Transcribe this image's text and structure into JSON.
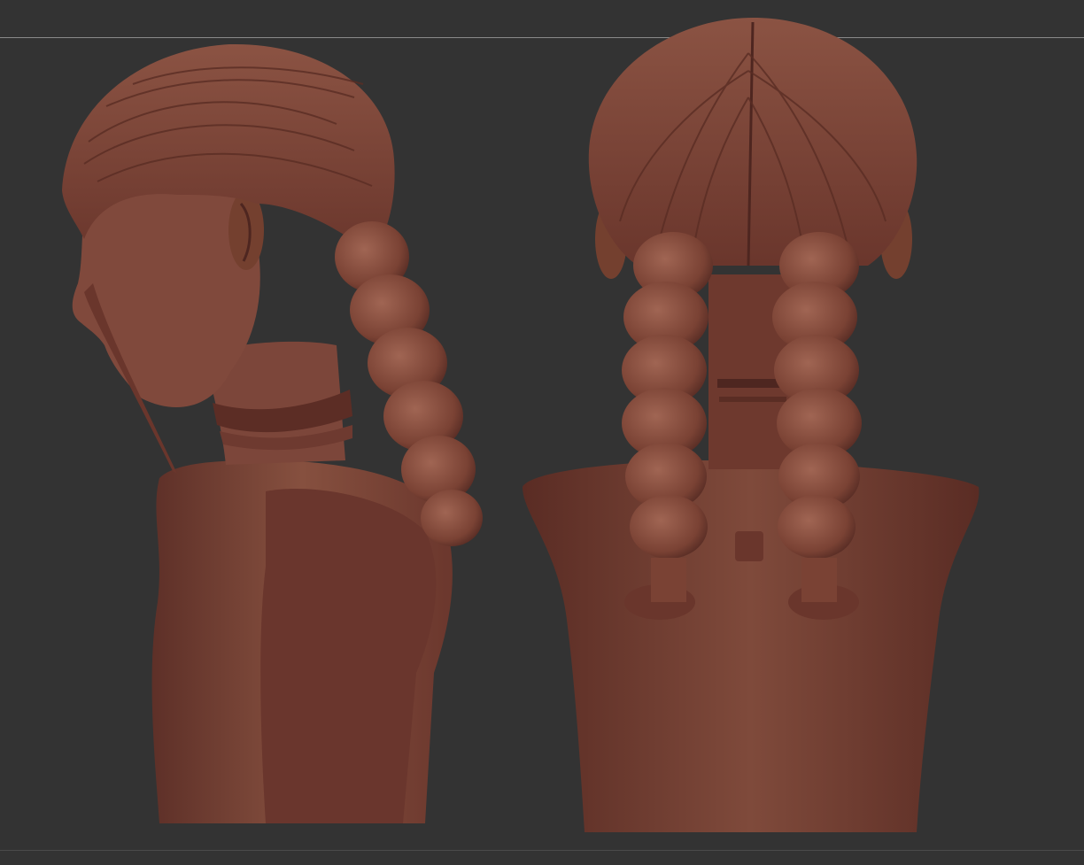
{
  "scene": {
    "background_color": "#333333",
    "material_color": "#7a4439",
    "views": [
      {
        "name": "side-profile-view",
        "description_icon": "sculpt-bust-side"
      },
      {
        "name": "back-view",
        "description_icon": "sculpt-bust-back"
      }
    ]
  }
}
